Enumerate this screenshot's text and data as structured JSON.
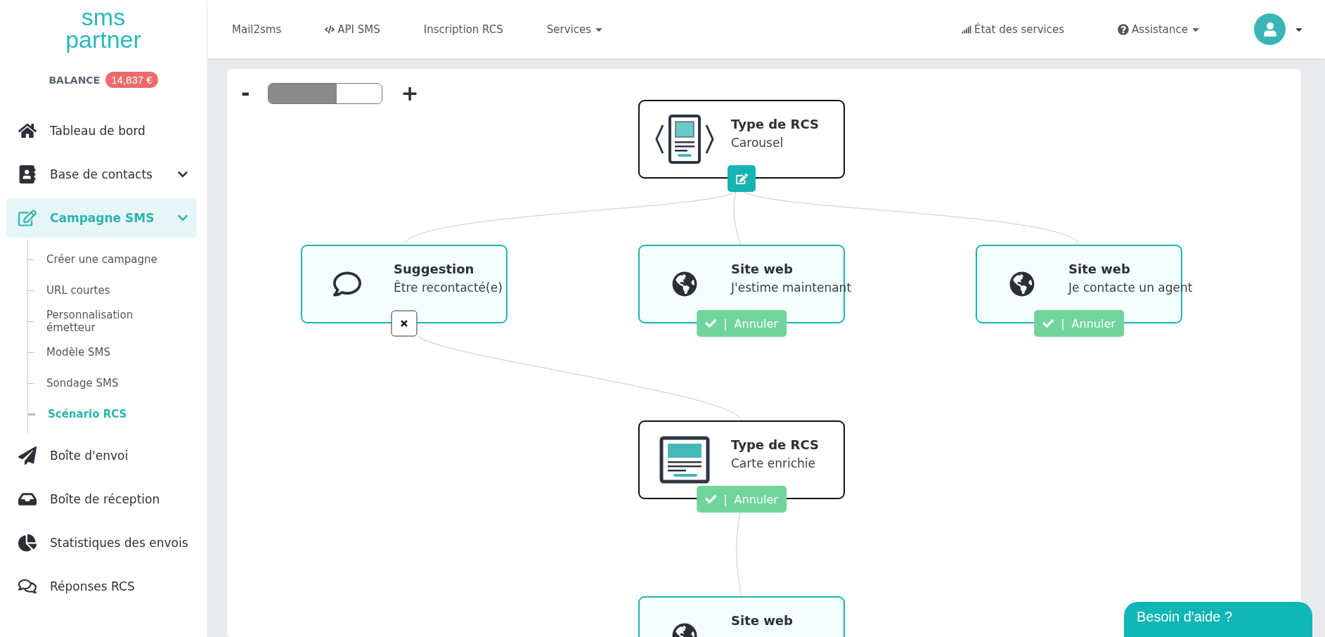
{
  "logo": {
    "line1": "sms",
    "line2": "partner"
  },
  "balance": {
    "label": "BALANCE",
    "amount": "14,837 €"
  },
  "sidebar": {
    "items": [
      {
        "label": "Tableau de bord",
        "selected": false,
        "has_submenu": false
      },
      {
        "label": "Base de contacts",
        "selected": false,
        "has_submenu": true
      },
      {
        "label": "Campagne SMS",
        "selected": true,
        "has_submenu": true,
        "children": [
          {
            "label": "Créer une campagne",
            "selected": false
          },
          {
            "label": "URL courtes",
            "selected": false
          },
          {
            "label": "Personnalisation émetteur",
            "selected": false
          },
          {
            "label": "Modèle SMS",
            "selected": false
          },
          {
            "label": "Sondage SMS",
            "selected": false
          },
          {
            "label": "Scénario RCS",
            "selected": true
          }
        ]
      },
      {
        "label": "Boîte d'envoi",
        "selected": false,
        "has_submenu": false
      },
      {
        "label": "Boîte de réception",
        "selected": false,
        "has_submenu": false
      },
      {
        "label": "Statistiques des envois",
        "selected": false,
        "has_submenu": false
      },
      {
        "label": "Réponses RCS",
        "selected": false,
        "has_submenu": false
      }
    ]
  },
  "topbar": {
    "links": [
      {
        "label": "Mail2sms",
        "caret": false
      },
      {
        "label": "API SMS",
        "caret": false
      },
      {
        "label": "Inscription RCS",
        "caret": false
      },
      {
        "label": "Services",
        "caret": true
      }
    ],
    "right_links": [
      {
        "label": "État des services",
        "caret": false
      },
      {
        "label": "Assistance",
        "caret": true
      }
    ],
    "account": {
      "caret": true
    }
  },
  "zoom": {
    "minus": "-",
    "plus": "+",
    "level": 0.6
  },
  "nodes": [
    {
      "kind": "rcs_type",
      "title": "Type de RCS",
      "subtitle": "Carousel",
      "badge": {
        "kind": "edit"
      }
    },
    {
      "kind": "suggestion",
      "title": "Suggestion",
      "subtitle": "Être recontacté(e)",
      "badge": {
        "kind": "remove"
      }
    },
    {
      "kind": "website",
      "title": "Site web",
      "subtitle": "J'estime maintenant",
      "badge": {
        "kind": "confirm",
        "separator": "|",
        "label": "Annuler"
      }
    },
    {
      "kind": "website",
      "title": "Site web",
      "subtitle": "Je contacte un agent",
      "badge": {
        "kind": "confirm",
        "separator": "|",
        "label": "Annuler"
      }
    },
    {
      "kind": "rich_card",
      "title": "Type de RCS",
      "subtitle": "Carte enrichie",
      "badge": {
        "kind": "confirm",
        "separator": "|",
        "label": "Annuler"
      }
    },
    {
      "kind": "website",
      "title": "Site web"
    }
  ],
  "help_button": {
    "label": "Besoin d'aide ?"
  }
}
